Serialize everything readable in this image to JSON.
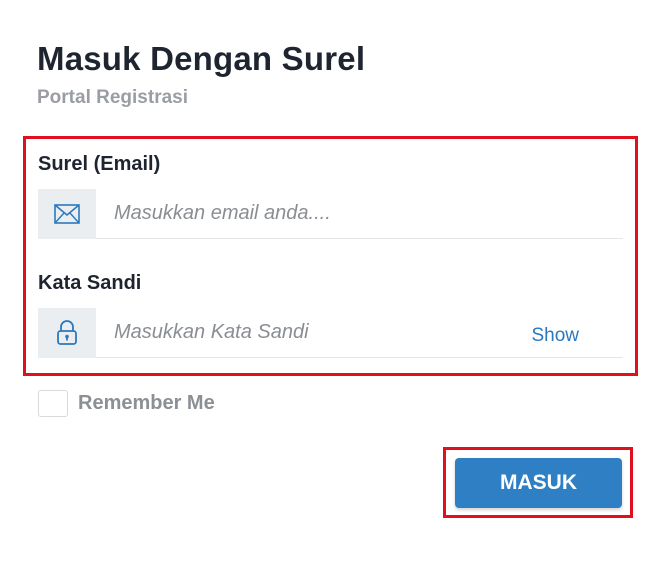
{
  "header": {
    "title": "Masuk Dengan Surel",
    "subtitle": "Portal Registrasi"
  },
  "form": {
    "email": {
      "label": "Surel (Email)",
      "placeholder": "Masukkan email anda....",
      "value": "",
      "icon": "envelope-icon"
    },
    "password": {
      "label": "Kata Sandi",
      "placeholder": "Masukkan Kata Sandi",
      "value": "",
      "icon": "lock-icon",
      "toggle_label": "Show"
    },
    "remember": {
      "label": "Remember Me",
      "checked": false
    },
    "submit_label": "MASUK"
  },
  "colors": {
    "primary": "#2f7fc4",
    "highlight_border": "#e0101e",
    "addon_bg": "#eaeef0",
    "link": "#2b78be"
  }
}
